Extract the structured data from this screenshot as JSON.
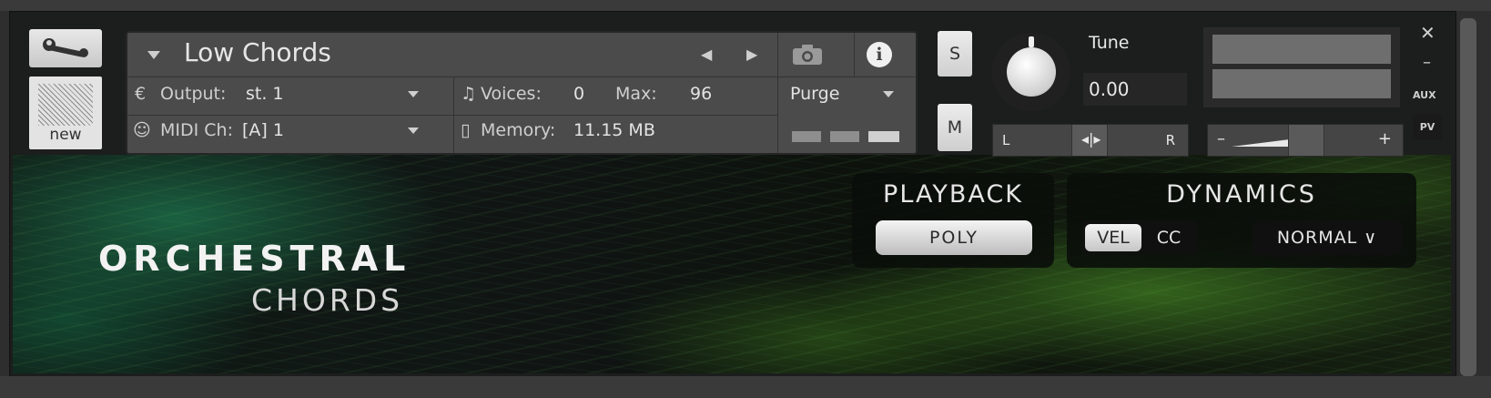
{
  "header": {
    "instrument_name": "Low Chords",
    "new_label": "new",
    "output_label": "Output:",
    "output_value": "st. 1",
    "midi_label": "MIDI Ch:",
    "midi_value": "[A]  1",
    "voices_label": "Voices:",
    "voices_value": "0",
    "max_label": "Max:",
    "max_value": "96",
    "memory_label": "Memory:",
    "memory_value": "11.15 MB",
    "purge_label": "Purge",
    "info_glyph": "i",
    "prev_glyph": "◀",
    "next_glyph": "▶"
  },
  "right_controls": {
    "solo_label": "S",
    "mute_label": "M",
    "tune_label": "Tune",
    "tune_value": "0.00",
    "pan_left": "L",
    "pan_right": "R",
    "pan_glyph": "◂|▸",
    "vol_minus": "–",
    "vol_plus": "+",
    "close_glyph": "✕",
    "minimize_glyph": "–",
    "aux_label": "AUX",
    "pv_label": "PV"
  },
  "instrument": {
    "title_line1": "ORCHESTRAL",
    "title_line2": "CHORDS",
    "playback": {
      "title": "PLAYBACK",
      "mode": "POLY"
    },
    "dynamics": {
      "title": "DYNAMICS",
      "vel_label": "VEL",
      "cc_label": "CC",
      "selected_source": "VEL",
      "curve_value": "NORMAL ∨"
    }
  },
  "icons": [
    "wrench-icon",
    "camera-icon",
    "info-icon",
    "output-icon",
    "midi-icon",
    "voices-icon",
    "memory-icon",
    "tune-knob",
    "dropdown-icon"
  ],
  "colors": {
    "panel": "#4b4b4b",
    "frame": "#1c1d1d",
    "button": "#e3e3e3",
    "accent_green": "#3c8c3c"
  }
}
